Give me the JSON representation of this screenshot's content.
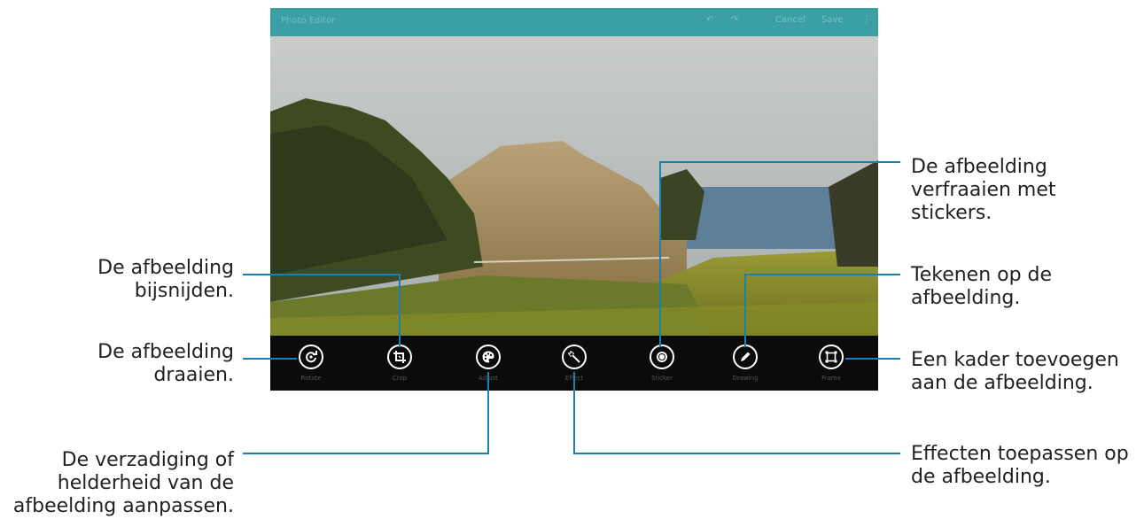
{
  "app": {
    "title": "Photo Editor",
    "actions": {
      "undo": "↶",
      "redo": "↷",
      "cancel": "Cancel",
      "save": "Save"
    }
  },
  "tools": [
    {
      "id": "rotate",
      "label": "Rotate"
    },
    {
      "id": "crop",
      "label": "Crop"
    },
    {
      "id": "adjust",
      "label": "Adjust"
    },
    {
      "id": "effect",
      "label": "Effect"
    },
    {
      "id": "sticker",
      "label": "Sticker"
    },
    {
      "id": "drawing",
      "label": "Drawing"
    },
    {
      "id": "frame",
      "label": "Frame"
    }
  ],
  "callouts": {
    "crop": [
      "De afbeelding",
      "bijsnijden."
    ],
    "rotate": [
      "De afbeelding",
      "draaien."
    ],
    "adjust": [
      "De verzadiging of",
      "helderheid van de",
      "afbeelding aanpassen."
    ],
    "sticker": [
      "De afbeelding",
      "verfraaien met",
      "stickers."
    ],
    "drawing": [
      "Tekenen op de",
      "afbeelding."
    ],
    "frame": [
      "Een kader toevoegen",
      "aan de afbeelding."
    ],
    "effect": [
      "Effecten toepassen op",
      "de afbeelding."
    ]
  },
  "colors": {
    "accent_line": "#1b7fb0",
    "actionbar": "#3aa0a6"
  }
}
